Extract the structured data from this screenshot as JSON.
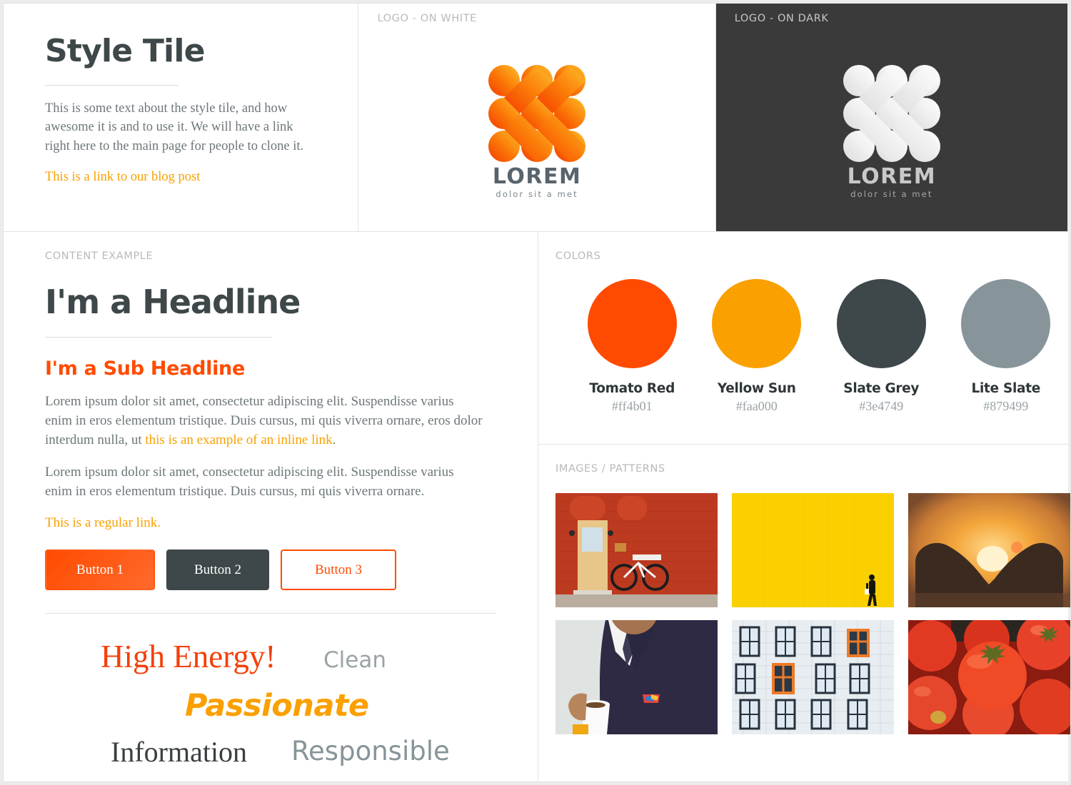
{
  "intro": {
    "title": "Style Tile",
    "paragraph": "This is some text about the style tile, and how awesome it is and to use it. We will have a link right here to the main page for people to clone it.",
    "link_label": "This is a link to our blog post"
  },
  "logo_white": {
    "label": "LOGO - ON WHITE",
    "wordmark": "LOREM",
    "tagline": "dolor sit a met"
  },
  "logo_dark": {
    "label": "LOGO - ON DARK",
    "wordmark": "LOREM",
    "tagline": "dolor sit a met"
  },
  "content": {
    "label": "CONTENT EXAMPLE",
    "headline": "I'm a Headline",
    "subheadline": "I'm a Sub Headline",
    "paragraph1_before": "Lorem ipsum dolor sit amet, consectetur adipiscing elit. Suspendisse varius enim in eros elementum tristique. Duis cursus, mi quis viverra ornare, eros dolor interdum nulla, ut ",
    "paragraph1_link": "this is an example of an inline link",
    "paragraph1_after": ".",
    "paragraph2": "Lorem ipsum dolor sit amet, consectetur adipiscing elit. Suspendisse varius enim in eros elementum tristique. Duis cursus, mi quis viverra ornare.",
    "regular_link": "This is a regular link.",
    "buttons": [
      {
        "label": "Button 1",
        "style": "filled-orange"
      },
      {
        "label": "Button 2",
        "style": "filled-slate"
      },
      {
        "label": "Button 3",
        "style": "outline-orange"
      }
    ],
    "mood_words": [
      {
        "text": "High Energy!",
        "color": "#f43f08"
      },
      {
        "text": "Clean",
        "color": "#9aa3a6"
      },
      {
        "text": "Passionate",
        "color": "#faa000"
      },
      {
        "text": "Information",
        "color": "#3a3f41"
      },
      {
        "text": "Responsible",
        "color": "#879499"
      }
    ]
  },
  "colors": {
    "label": "COLORS",
    "swatches": [
      {
        "name": "Tomato Red",
        "hex": "#ff4b01"
      },
      {
        "name": "Yellow Sun",
        "hex": "#faa000"
      },
      {
        "name": "Slate Grey",
        "hex": "#3e4749"
      },
      {
        "name": "Lite Slate",
        "hex": "#879499"
      }
    ]
  },
  "images": {
    "label": "IMAGES / PATTERNS",
    "items": [
      {
        "name": "red-brick-door-bicycle"
      },
      {
        "name": "yellow-wall-walking-person"
      },
      {
        "name": "hands-heart-sunset"
      },
      {
        "name": "man-in-suit-with-coffee"
      },
      {
        "name": "building-windows-orange-accent"
      },
      {
        "name": "fresh-red-tomatoes"
      }
    ]
  },
  "theme": {
    "accent_orange": "#ff4b01",
    "accent_yellow": "#faa000",
    "slate": "#3e4749",
    "lite_slate": "#879499",
    "dark_panel_bg": "#3a3a3a"
  }
}
